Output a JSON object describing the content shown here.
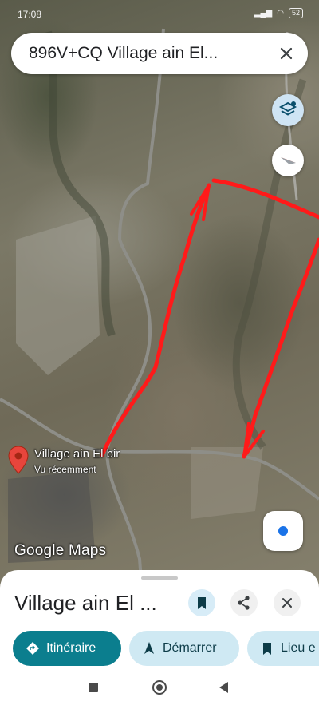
{
  "status_bar": {
    "time": "17:08",
    "battery": "52"
  },
  "search": {
    "query": "896V+CQ Village ain El..."
  },
  "map": {
    "pin_label": "Village ain El bir",
    "pin_sublabel": "Vu récemment",
    "attribution": "Google Maps"
  },
  "place_sheet": {
    "title": "Village ain El ...",
    "chips": [
      {
        "label": "Itinéraire",
        "icon": "directions-icon"
      },
      {
        "label": "Démarrer",
        "icon": "navigation-arrow-icon"
      },
      {
        "label": "Lieu e",
        "icon": "bookmark-icon"
      }
    ]
  },
  "colors": {
    "accent": "#0b7e8e",
    "chip_secondary": "#cfe9f3",
    "drawing": "#ff1a1a",
    "pin": "#e8453c",
    "locate_dot": "#1a73e8"
  }
}
